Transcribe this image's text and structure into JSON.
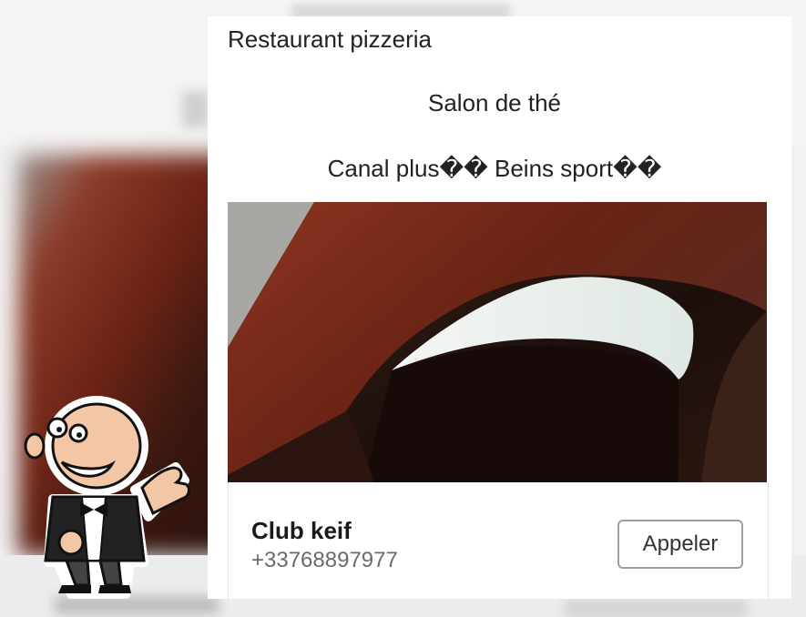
{
  "card": {
    "lines": [
      "Restaurant pizzeria",
      "Salon de thé",
      "Canal plus�� Beins sport��"
    ]
  },
  "business": {
    "name": "Club keif",
    "phone": "+33768897977",
    "call_label": "Appeler"
  },
  "colors": {
    "lip": "#7a2a1a",
    "tooth": "#e8eeea",
    "button_border": "#9e9e9e"
  },
  "icons": {
    "mascot": "thumbs-up-waiter-icon"
  }
}
